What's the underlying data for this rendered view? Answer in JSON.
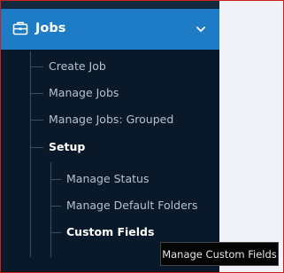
{
  "nav": {
    "jobs_label": "Jobs",
    "items": [
      {
        "label": "Create Job"
      },
      {
        "label": "Manage Jobs"
      },
      {
        "label": "Manage Jobs: Grouped"
      },
      {
        "label": "Setup"
      }
    ],
    "setup_items": [
      {
        "label": "Manage Status"
      },
      {
        "label": "Manage Default Folders"
      },
      {
        "label": "Custom Fields"
      }
    ]
  },
  "tooltip": {
    "text": "Manage Custom Fields"
  },
  "colors": {
    "header": "#1e7bc6",
    "sidebar": "#0a1929",
    "background": "#f1f2f7"
  }
}
